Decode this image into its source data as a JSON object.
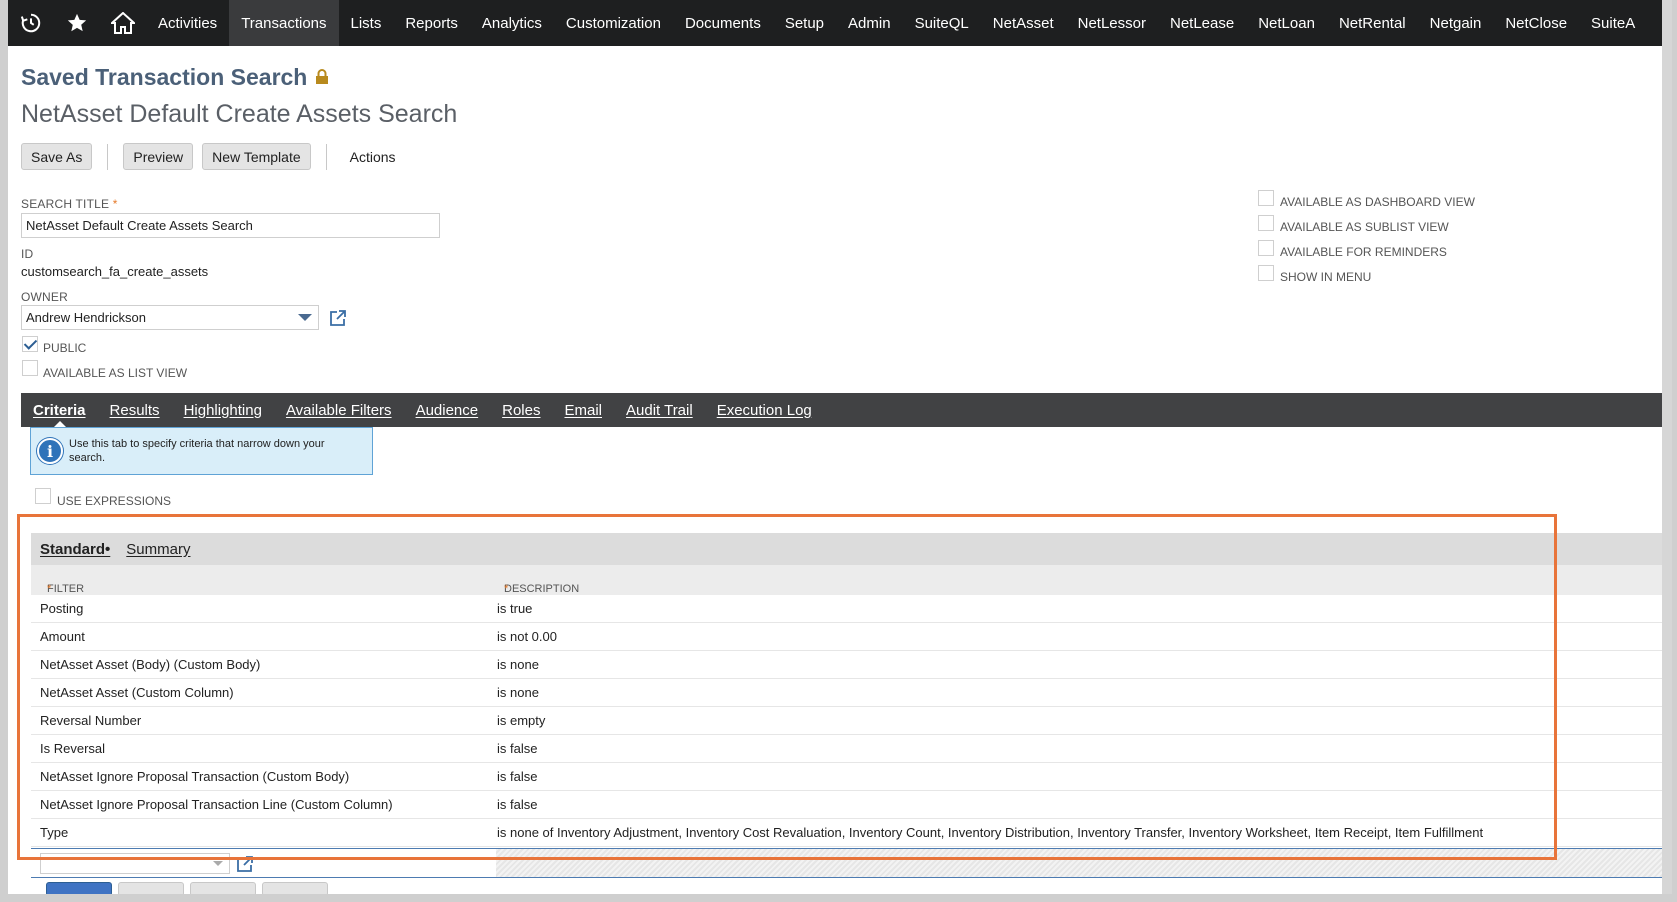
{
  "nav": {
    "items": [
      "Activities",
      "Transactions",
      "Lists",
      "Reports",
      "Analytics",
      "Customization",
      "Documents",
      "Setup",
      "Admin",
      "SuiteQL",
      "NetAsset",
      "NetLessor",
      "NetLease",
      "NetLoan",
      "NetRental",
      "Netgain",
      "NetClose",
      "SuiteA"
    ],
    "active": "Transactions"
  },
  "page": {
    "title": "Saved Transaction Search",
    "subtitle": "NetAsset Default Create Assets Search"
  },
  "buttons": {
    "save_as": "Save As",
    "preview": "Preview",
    "new_template": "New Template",
    "actions": "Actions"
  },
  "form": {
    "search_title_label": "SEARCH TITLE",
    "required_mark": "*",
    "search_title_value": "NetAsset Default Create Assets Search",
    "id_label": "ID",
    "id_value": "customsearch_fa_create_assets",
    "owner_label": "OWNER",
    "owner_value": "Andrew Hendrickson",
    "public_label": "PUBLIC",
    "public_checked": true,
    "available_list_label": "AVAILABLE AS LIST VIEW",
    "available_list_checked": false
  },
  "right_options": [
    {
      "label": "AVAILABLE AS DASHBOARD VIEW",
      "checked": false
    },
    {
      "label": "AVAILABLE AS SUBLIST VIEW",
      "checked": false
    },
    {
      "label": "AVAILABLE FOR REMINDERS",
      "checked": false
    },
    {
      "label": "SHOW IN MENU",
      "checked": false
    }
  ],
  "subtabs": [
    "Criteria",
    "Results",
    "Highlighting",
    "Available Filters",
    "Audience",
    "Roles",
    "Email",
    "Audit Trail",
    "Execution Log"
  ],
  "info": {
    "text": "Use this tab to specify criteria that narrow down your search."
  },
  "use_expressions": {
    "label": "USE EXPRESSIONS",
    "checked": false
  },
  "criteria": {
    "tabs": [
      "Standard",
      "Summary"
    ],
    "active_tab_marker": "•",
    "columns": {
      "filter": "FILTER",
      "description": "DESCRIPTION"
    },
    "rows": [
      {
        "filter": "Posting",
        "description": "is true"
      },
      {
        "filter": "Amount",
        "description": "is not 0.00"
      },
      {
        "filter": "NetAsset Asset (Body) (Custom Body)",
        "description": "is none"
      },
      {
        "filter": "NetAsset Asset (Custom Column)",
        "description": "is none"
      },
      {
        "filter": "Reversal Number",
        "description": "is empty"
      },
      {
        "filter": "Is Reversal",
        "description": "is false"
      },
      {
        "filter": "NetAsset Ignore Proposal Transaction (Custom Body)",
        "description": "is false"
      },
      {
        "filter": "NetAsset Ignore Proposal Transaction Line (Custom Column)",
        "description": "is false"
      },
      {
        "filter": "Type",
        "description": "is none of Inventory Adjustment, Inventory Cost Revaluation, Inventory Count, Inventory Distribution, Inventory Transfer, Inventory Worksheet, Item Receipt, Item Fulfillment"
      }
    ]
  },
  "colors": {
    "nav_bg": "#1e1f20",
    "title": "#4b6078",
    "highlight": "#e8743a",
    "info_bg": "#d9eef9"
  },
  "icons": [
    "history-icon",
    "star-icon",
    "home-icon",
    "lock-icon",
    "external-link-icon",
    "info-icon"
  ]
}
